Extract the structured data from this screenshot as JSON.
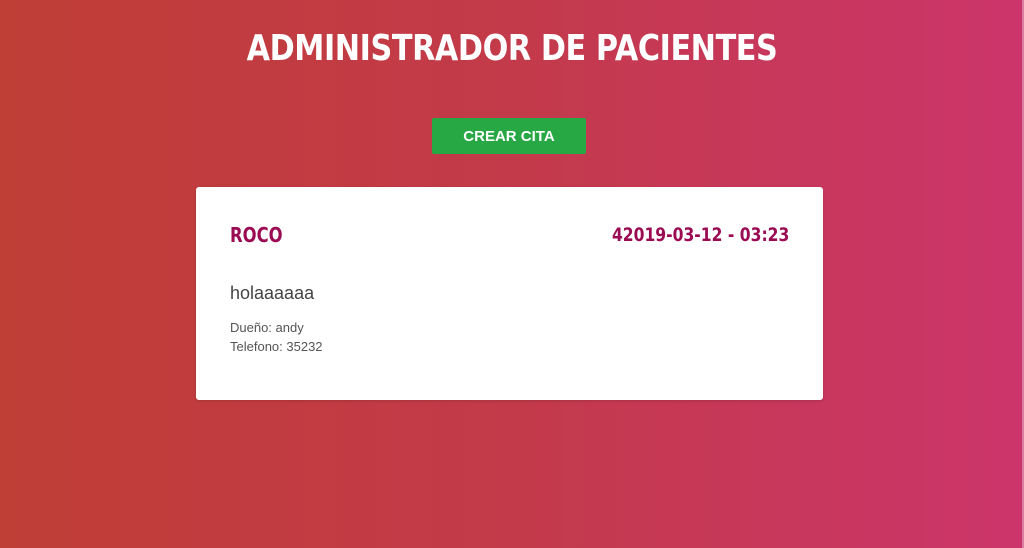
{
  "header": {
    "title": "ADMINISTRADOR DE PACIENTES"
  },
  "actions": {
    "create_label": "CREAR CITA"
  },
  "appointment": {
    "pet_name": "ROCO",
    "datetime": "42019-03-12 - 03:23",
    "symptoms": "holaaaaaa",
    "owner_line": "Dueño: andy",
    "phone_line": "Telefono: 35232"
  },
  "colors": {
    "gradient_start": "#bf3e36",
    "gradient_end": "#cc356b",
    "button_green": "#28a745",
    "accent_text": "#9b0b53"
  }
}
